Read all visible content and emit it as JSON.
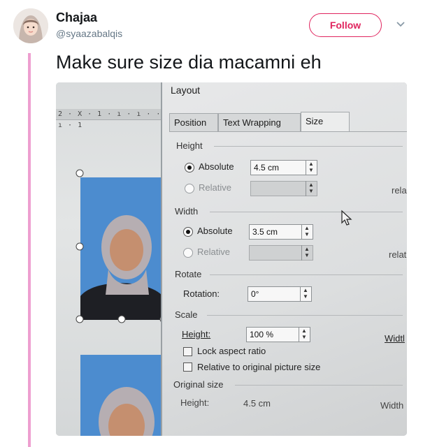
{
  "tweet": {
    "display_name": "Chajaa",
    "handle": "@syaazabalqis",
    "follow_label": "Follow",
    "text": "Make sure size dia macamni eh"
  },
  "colors": {
    "thread_line": "#ee9fd0",
    "follow_accent": "#e0245e"
  },
  "photo": {
    "ruler_text": "2 · X · 1 · ı · ı ·   · ı · 1",
    "dialog": {
      "title": "Layout",
      "tabs": [
        "Position",
        "Text Wrapping",
        "Size"
      ],
      "active_tab": "Size",
      "height_section": "Height",
      "height_absolute_label": "Absolute",
      "height_absolute_value": "4.5 cm",
      "height_relative_label": "Relative",
      "height_relative_suffix": "rela",
      "width_section": "Width",
      "width_absolute_label": "Absolute",
      "width_absolute_value": "3.5 cm",
      "width_relative_label": "Relative",
      "width_relative_suffix": "relat",
      "rotate_section": "Rotate",
      "rotation_label": "Rotation:",
      "rotation_value": "0°",
      "scale_section": "Scale",
      "scale_height_label": "Height:",
      "scale_height_value": "100 %",
      "scale_width_label": "Widtl",
      "lock_aspect_label": "Lock aspect ratio",
      "relative_original_label": "Relative to original picture size",
      "original_size_section": "Original size",
      "original_height_label": "Height:",
      "original_height_value": "4.5 cm",
      "original_width_label": "Width"
    }
  }
}
